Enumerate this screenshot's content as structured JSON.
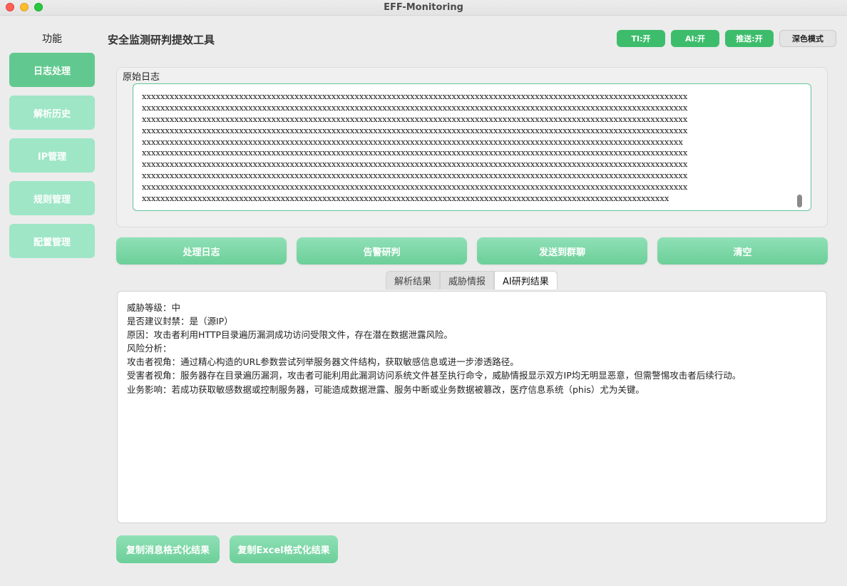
{
  "window": {
    "title": "EFF-Monitoring"
  },
  "sidebar": {
    "title": "功能",
    "items": [
      {
        "label": "日志处理",
        "active": true
      },
      {
        "label": "解析历史"
      },
      {
        "label": "IP管理"
      },
      {
        "label": "规则管理"
      },
      {
        "label": "配置管理"
      }
    ]
  },
  "header": {
    "title": "安全监测研判提效工具",
    "toggles": {
      "ti": "TI:开",
      "ai": "AI:开",
      "push": "推送:开",
      "theme": "深色模式"
    }
  },
  "raw_log": {
    "label": "原始日志",
    "lines": [
      "xxxxxxxxxxxxxxxxxxxxxxxxxxxxxxxxxxxxxxxxxxxxxxxxxxxxxxxxxxxxxxxxxxxxxxxxxxxxxxxxxxxxxxxxxxxxxxxxxxxxxxxxxxxxxxxxxxxxxx",
      "xxxxxxxxxxxxxxxxxxxxxxxxxxxxxxxxxxxxxxxxxxxxxxxxxxxxxxxxxxxxxxxxxxxxxxxxxxxxxxxxxxxxxxxxxxxxxxxxxxxxxxxxxxxxxxxxxxxxxx",
      "xxxxxxxxxxxxxxxxxxxxxxxxxxxxxxxxxxxxxxxxxxxxxxxxxxxxxxxxxxxxxxxxxxxxxxxxxxxxxxxxxxxxxxxxxxxxxxxxxxxxxxxxxxxxxxxxxxxxxx",
      "xxxxxxxxxxxxxxxxxxxxxxxxxxxxxxxxxxxxxxxxxxxxxxxxxxxxxxxxxxxxxxxxxxxxxxxxxxxxxxxxxxxxxxxxxxxxxxxxxxxxxxxxxxxxxxxxxxxxxx",
      "xxxxxxxxxxxxxxxxxxxxxxxxxxxxxxxxxxxxxxxxxxxxxxxxxxxxxxxxxxxxxxxxxxxxxxxxxxxxxxxxxxxxxxxxxxxxxxxxxxxxxxxxxxxxxxxxxxxxx",
      "xxxxxxxxxxxxxxxxxxxxxxxxxxxxxxxxxxxxxxxxxxxxxxxxxxxxxxxxxxxxxxxxxxxxxxxxxxxxxxxxxxxxxxxxxxxxxxxxxxxxxxxxxxxxxxxxxxxxxx",
      "xxxxxxxxxxxxxxxxxxxxxxxxxxxxxxxxxxxxxxxxxxxxxxxxxxxxxxxxxxxxxxxxxxxxxxxxxxxxxxxxxxxxxxxxxxxxxxxxxxxxxxxxxxxxxxxxxxxxxx",
      "xxxxxxxxxxxxxxxxxxxxxxxxxxxxxxxxxxxxxxxxxxxxxxxxxxxxxxxxxxxxxxxxxxxxxxxxxxxxxxxxxxxxxxxxxxxxxxxxxxxxxxxxxxxxxxxxxxxxxx",
      "xxxxxxxxxxxxxxxxxxxxxxxxxxxxxxxxxxxxxxxxxxxxxxxxxxxxxxxxxxxxxxxxxxxxxxxxxxxxxxxxxxxxxxxxxxxxxxxxxxxxxxxxxxxxxxxxxxxxxx",
      "xxxxxxxxxxxxxxxxxxxxxxxxxxxxxxxxxxxxxxxxxxxxxxxxxxxxxxxxxxxxxxxxxxxxxxxxxxxxxxxxxxxxxxxxxxxxxxxxxxxxxxxxxxxxxxxxxx"
    ]
  },
  "actions": {
    "process": "处理日志",
    "alert_judge": "告警研判",
    "send_group": "发送到群聊",
    "clear": "清空"
  },
  "tabs": [
    {
      "label": "解析结果"
    },
    {
      "label": "威胁情报"
    },
    {
      "label": "AI研判结果",
      "active": true
    }
  ],
  "ai_result": {
    "lines": [
      "威胁等级：中",
      "是否建议封禁：是（源IP）",
      "原因：攻击者利用HTTP目录遍历漏洞成功访问受限文件，存在潜在数据泄露风险。",
      "风险分析：",
      "攻击者视角：通过精心构造的URL参数尝试列举服务器文件结构，获取敏感信息或进一步渗透路径。",
      "受害者视角：服务器存在目录遍历漏洞，攻击者可能利用此漏洞访问系统文件甚至执行命令，威胁情报显示双方IP均无明显恶意，但需警惕攻击者后续行动。",
      "业务影响：若成功获取敏感数据或控制服务器，可能造成数据泄露、服务中断或业务数据被篡改，医疗信息系统（phis）尤为关键。"
    ]
  },
  "copy": {
    "message_format": "复制消息格式化结果",
    "excel_format": "复制Excel格式化结果"
  },
  "colors": {
    "nav_active": "#61c98f",
    "nav_inactive": "#9ee6c6",
    "toggle_on": "#3dbd6b",
    "accent_border": "#62c59a"
  }
}
